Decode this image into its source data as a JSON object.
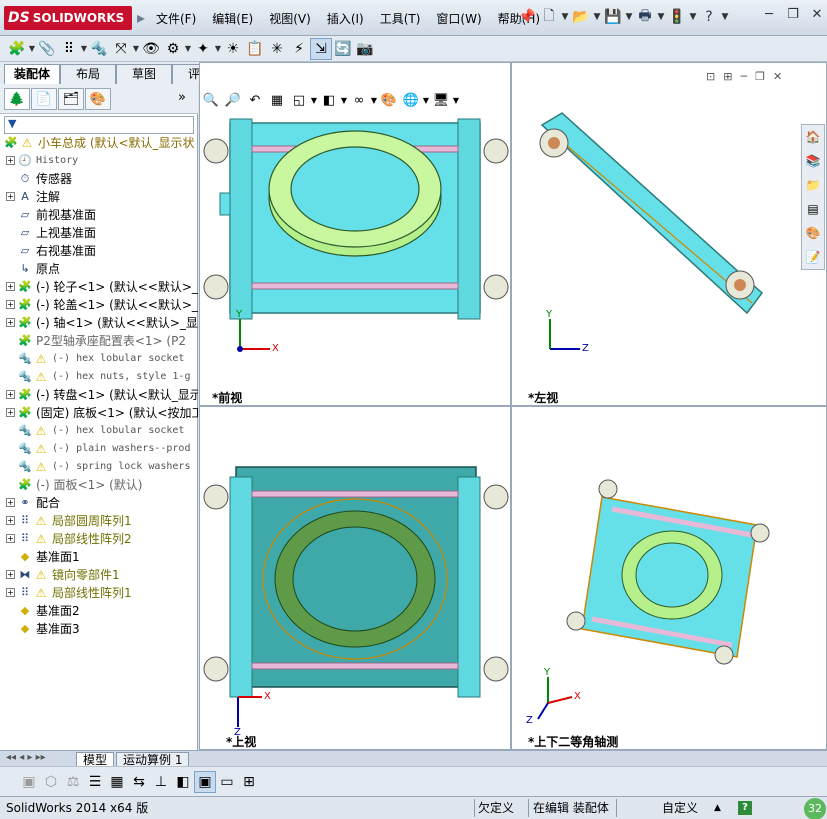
{
  "app": {
    "logo_ds": "DS",
    "logo_text": "SOLIDWORKS"
  },
  "menu": [
    "文件(F)",
    "编辑(E)",
    "视图(V)",
    "插入(I)",
    "工具(T)",
    "窗口(W)",
    "帮助(H)"
  ],
  "cm_tabs": [
    "装配体",
    "布局",
    "草图",
    "评估"
  ],
  "fm_more": "»",
  "tree": [
    {
      "label": "小车总成",
      "suffix": "(默认<默认_显示状",
      "icon": "assembly",
      "warn": true,
      "exp": false,
      "color": "#8a6a00"
    },
    {
      "label": "History",
      "icon": "history",
      "warn": false,
      "exp": true,
      "mono": true
    },
    {
      "label": "传感器",
      "icon": "sensor",
      "warn": false,
      "exp": false
    },
    {
      "label": "注解",
      "icon": "annotation",
      "warn": false,
      "exp": true
    },
    {
      "label": "前视基准面",
      "icon": "plane",
      "warn": false,
      "exp": false
    },
    {
      "label": "上视基准面",
      "icon": "plane",
      "warn": false,
      "exp": false
    },
    {
      "label": "右视基准面",
      "icon": "plane",
      "warn": false,
      "exp": false
    },
    {
      "label": "原点",
      "icon": "origin",
      "warn": false,
      "exp": false
    },
    {
      "label": "(-) 轮子<1> (默认<<默认>_显",
      "icon": "part",
      "warn": false,
      "exp": true
    },
    {
      "label": "(-) 轮盖<1> (默认<<默认>_显",
      "icon": "part",
      "warn": false,
      "exp": true
    },
    {
      "label": "(-) 轴<1> (默认<<默认>_显示",
      "icon": "part",
      "warn": false,
      "exp": true
    },
    {
      "label": "P2型轴承座配置表<1> (P2",
      "icon": "part-gray",
      "warn": false,
      "exp": false,
      "gray": true
    },
    {
      "label": "(-) hex lobular socket",
      "icon": "screw",
      "warn": true,
      "exp": false,
      "mono": true
    },
    {
      "label": "(-) hex nuts, style 1-g",
      "icon": "screw",
      "warn": true,
      "exp": false,
      "mono": true
    },
    {
      "label": "(-) 转盘<1> (默认<默认_显示",
      "icon": "part",
      "warn": false,
      "exp": true
    },
    {
      "label": "(固定) 底板<1> (默认<按加工",
      "icon": "part",
      "warn": false,
      "exp": true
    },
    {
      "label": "(-) hex lobular socket",
      "icon": "screw",
      "warn": true,
      "exp": false,
      "mono": true
    },
    {
      "label": "(-) plain washers--prod",
      "icon": "screw",
      "warn": true,
      "exp": false,
      "mono": true
    },
    {
      "label": "(-) spring lock washers",
      "icon": "screw",
      "warn": true,
      "exp": false,
      "mono": true
    },
    {
      "label": "(-) 面板<1> (默认)",
      "icon": "part-gray",
      "warn": false,
      "exp": false,
      "gray": true
    },
    {
      "label": "配合",
      "icon": "mates",
      "warn": false,
      "exp": true
    },
    {
      "label": "局部圆周阵列1",
      "icon": "pattern",
      "warn": true,
      "exp": true,
      "olive": true
    },
    {
      "label": "局部线性阵列2",
      "icon": "pattern",
      "warn": true,
      "exp": true,
      "olive": true
    },
    {
      "label": "基准面1",
      "icon": "plane-yellow",
      "warn": false,
      "exp": false
    },
    {
      "label": "镜向零部件1",
      "icon": "mirror",
      "warn": true,
      "exp": true,
      "olive": true
    },
    {
      "label": "局部线性阵列1",
      "icon": "pattern",
      "warn": true,
      "exp": true,
      "olive": true
    },
    {
      "label": "基准面2",
      "icon": "plane-yellow",
      "warn": false,
      "exp": false
    },
    {
      "label": "基准面3",
      "icon": "plane-yellow",
      "warn": false,
      "exp": false
    }
  ],
  "views": [
    {
      "label": "*前视"
    },
    {
      "label": "*左视"
    },
    {
      "label": "*上视"
    },
    {
      "label": "*上下二等角轴测"
    }
  ],
  "axes": {
    "x": "X",
    "y": "Y",
    "z": "Z"
  },
  "bottom_tabs": [
    "模型",
    "运动算例 1"
  ],
  "status": {
    "app": "SolidWorks 2014 x64 版",
    "undefined": "欠定义",
    "editing": "在编辑 装配体",
    "custom": "自定义",
    "caret": "▲",
    "help": "?",
    "badge": "32"
  },
  "colors": {
    "cyan": "#66e0e8",
    "teal": "#3fa8a8",
    "ring": "#b6f08a",
    "ring_dark": "#5f9a48",
    "roller": "#e8b8d8"
  }
}
